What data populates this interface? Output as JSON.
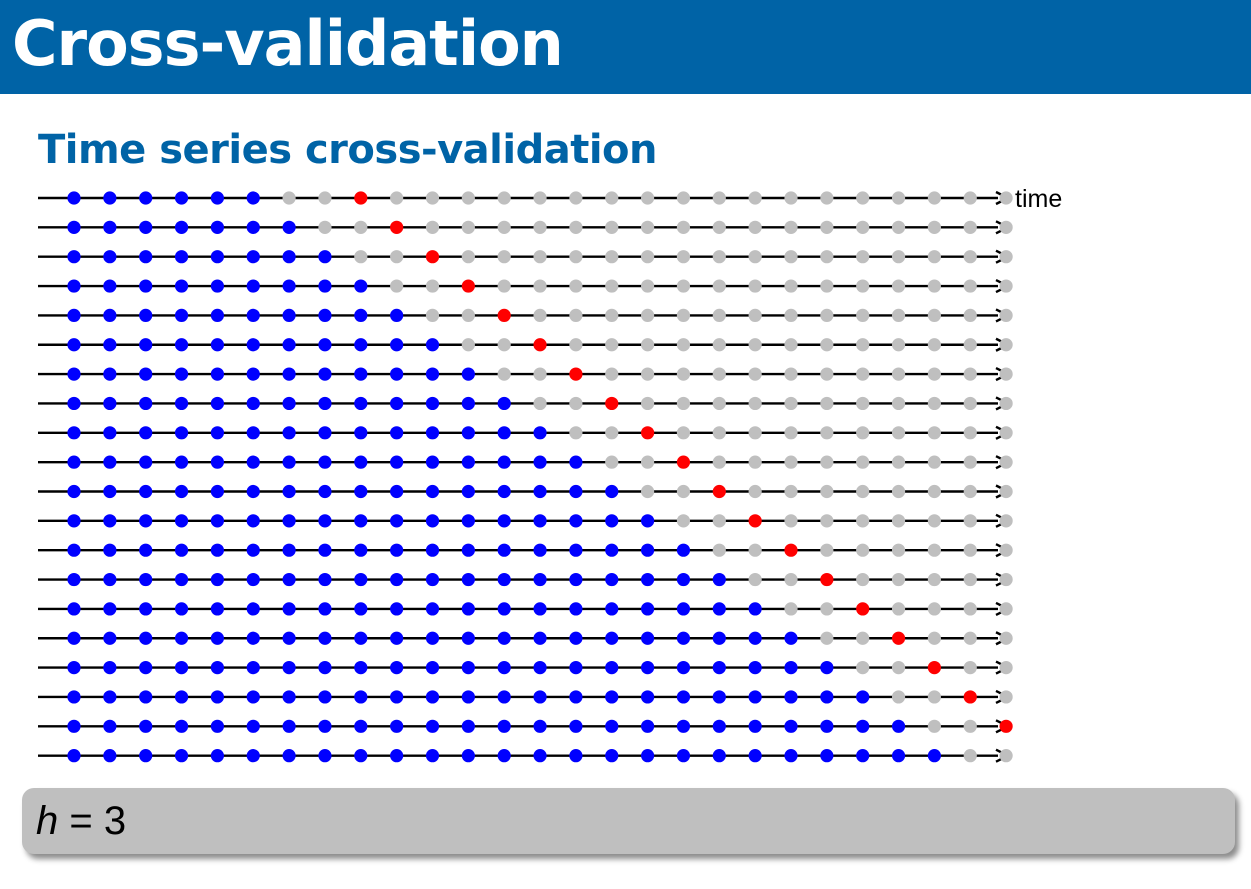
{
  "header": {
    "title": "Cross-validation"
  },
  "subtitle": "Time series cross-validation",
  "diagram": {
    "axis_label": "time",
    "num_points": 27,
    "num_rows": 20,
    "horizon": 3,
    "first_training_size": 6,
    "colors": {
      "training": "#0000ff",
      "test": "#ff0000",
      "unused": "#bfbfbf",
      "line": "#000000"
    }
  },
  "hbox": {
    "variable": "h",
    "equals": "= 3"
  }
}
